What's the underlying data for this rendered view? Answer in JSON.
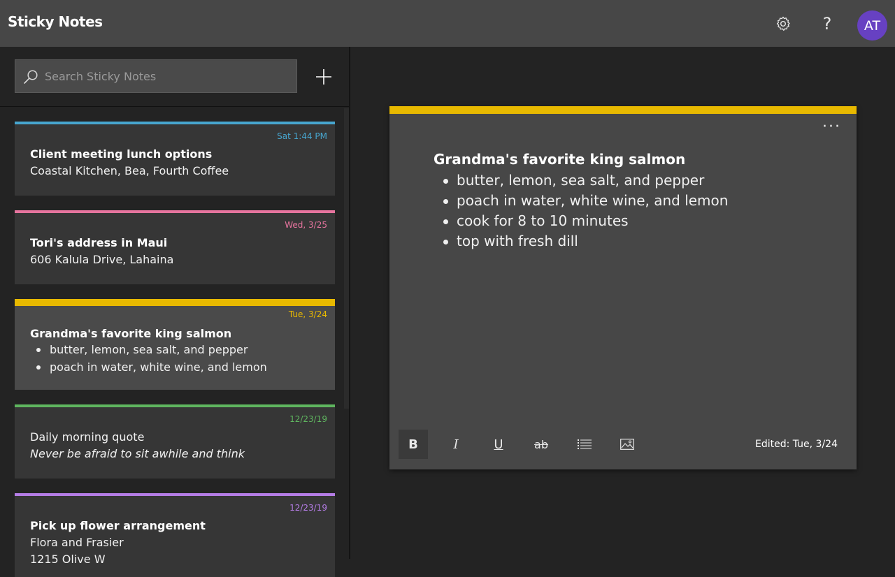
{
  "app": {
    "title": "Sticky Notes"
  },
  "header": {
    "settings_icon": "gear-icon",
    "help_icon": "help-icon",
    "help_glyph": "?",
    "avatar_initials": "AT",
    "avatar_color": "#6741c2"
  },
  "search": {
    "placeholder": "Search Sticky Notes",
    "value": ""
  },
  "notes": [
    {
      "date": "Sat 1:44 PM",
      "color": "#47a6cf",
      "title": "Client meeting lunch options",
      "lines": [
        "Coastal Kitchen, Bea, Fourth Coffee"
      ]
    },
    {
      "date": "Wed, 3/25",
      "color": "#e6749e",
      "title": "Tori's address in Maui",
      "lines": [
        "606 Kalula Drive, Lahaina"
      ]
    },
    {
      "date": "Tue, 3/24",
      "color": "#e8b900",
      "title": "Grandma's favorite king salmon",
      "bullets": [
        "butter, lemon, sea salt, and pepper",
        "poach in water, white wine, and lemon"
      ]
    },
    {
      "date": "12/23/19",
      "color": "#5fb55f",
      "lines": [
        "Daily morning quote"
      ],
      "italic": "Never be afraid to sit awhile and think"
    },
    {
      "date": "12/23/19",
      "color": "#b57de6",
      "title": "Pick up flower arrangement",
      "lines": [
        "Flora and Frasier",
        "1215 Olive W"
      ]
    }
  ],
  "editor": {
    "accent": "#e8b900",
    "more_label": "···",
    "title": "Grandma's favorite king salmon",
    "bullets": [
      "butter, lemon, sea salt, and pepper",
      "poach in water, white wine, and lemon",
      "cook for 8 to 10 minutes",
      "top with fresh dill"
    ],
    "toolbar": {
      "bold": "B",
      "italic": "I",
      "underline": "U",
      "strikethrough": "ab",
      "bullet_icon": "bullet-list-icon",
      "image_icon": "image-icon"
    },
    "edited": "Edited: Tue, 3/24"
  }
}
